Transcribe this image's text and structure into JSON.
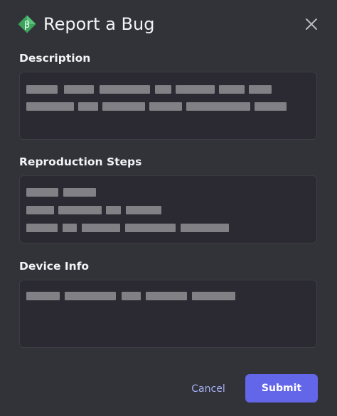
{
  "dialog": {
    "title": "Report a Bug",
    "icon": "beta-icon",
    "close_icon": "close-icon"
  },
  "fields": {
    "description": {
      "label": "Description"
    },
    "reproduction_steps": {
      "label": "Reproduction Steps"
    },
    "device_info": {
      "label": "Device Info"
    }
  },
  "actions": {
    "cancel_label": "Cancel",
    "submit_label": "Submit"
  },
  "colors": {
    "background": "#313338",
    "field_background": "#2b2a33",
    "accent": "#6366e8",
    "link": "#a6b2f5",
    "icon_green": "#3ba55d"
  }
}
